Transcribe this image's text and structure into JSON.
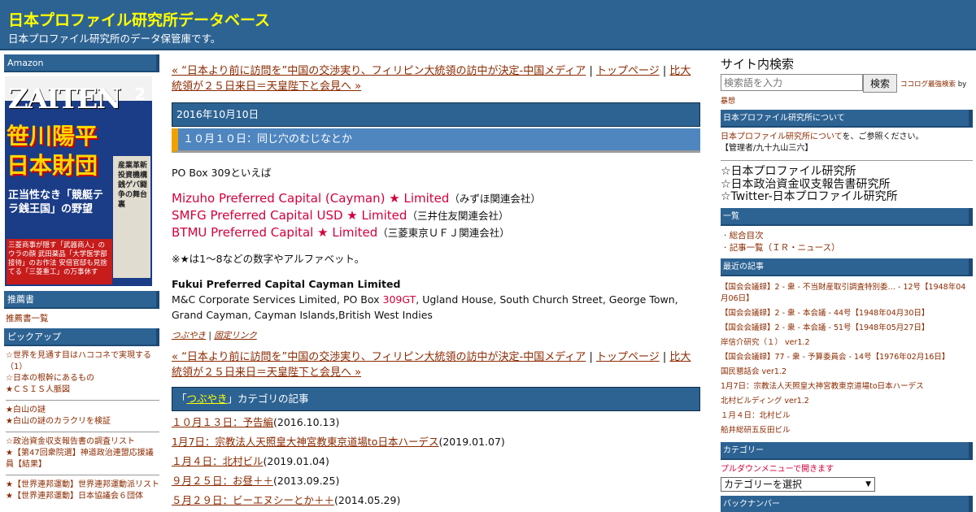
{
  "header": {
    "title": "日本プロファイル研究所データベース",
    "description": "日本プロファイル研究所のデータ保管庫です。"
  },
  "left": {
    "amazon_heading": "Amazon",
    "magazine": {
      "logo": "ZAITEN",
      "issue": "2",
      "headline": "笹川陽平 日本財団",
      "subline": "正当性なき「競艇テラ銭王国」の野望",
      "side_text": "産業革新投資機構 銭ゲバ闘争の舞台裏",
      "bottom_text": "三菱商事が隠す「武器商人」のウラの顔 武田薬品「大学医学部接待」のお作法 安倍官邸も見捨てる「三菱重工」の万事休す"
    },
    "recommend_heading": "推薦書",
    "recommend_link": "推薦書一覧",
    "pickup_heading": "ピックアップ",
    "pickup_groups": [
      [
        "☆世界を見通す目はハココネで実現する（1）",
        "☆日本の根幹にあるもの",
        "★ＣＳＩＳ人脈図"
      ],
      [
        "★白山の謎",
        "★白山の謎のカラクリを検証"
      ],
      [
        "☆政治資金収支報告書の調査リスト",
        "★【第47回衆院選】神道政治連盟応援議員【結果】"
      ],
      [
        "★【世界連邦運動】世界連邦運動派リスト",
        "★【世界連邦運動】日本協議会６団体"
      ]
    ]
  },
  "main": {
    "nav_prev": "« “日本より前に訪問を”中国の交渉実り、フィリピン大統領の訪中が決定-中国メディア",
    "nav_top": "トップページ",
    "nav_next": "比大統領が２５日来日＝天皇陛下と会見へ »",
    "nav_sep": " | ",
    "date": "2016年10月10日",
    "entry_title": "１０月１０日：同じ穴のむじなとか",
    "p1": "PO Box 309といえば",
    "red_lines": [
      {
        "name": "Mizuho Preferred Capital (Cayman) ★ Limited",
        "note": "（みずほ関連会社）"
      },
      {
        "name": "SMFG Preferred Capital USD ★ Limited",
        "note": "（三井住友関連会社）"
      },
      {
        "name": "BTMU Preferred Capital ★ Limited",
        "note": "（三菱東京ＵＦＪ関連会社）"
      }
    ],
    "p2": "※★は1〜8などの数字やアルファベット。",
    "company": "Fukui Preferred Capital Cayman Limited",
    "addr_prefix": "M&C Corporate Services Limited, PO Box ",
    "addr_highlight": "309GT",
    "addr_suffix": ", Ugland House, South Church Street, George Town, Grand Cayman, Cayman Islands,British West Indies",
    "cat_link": "つぶやき",
    "permalink": "固定リンク",
    "category_bar_prefix": "「",
    "category_bar_link": "つぶやき",
    "category_bar_suffix": "」カテゴリの記事",
    "category_items": [
      {
        "title": "１０月１３日：予告編",
        "date": "(2016.10.13)"
      },
      {
        "title": "1月7日：宗教法人天照皇大神宮教東京道場to日本ハーデス",
        "date": "(2019.01.07)"
      },
      {
        "title": "１月４日：北村ビル",
        "date": "(2019.01.04)"
      },
      {
        "title": "９月２５日：お昼＋＋",
        "date": "(2013.09.25)"
      },
      {
        "title": "５月２９日：ビーエヌシーとか＋＋",
        "date": "(2014.05.29)"
      }
    ]
  },
  "right": {
    "search_title": "サイト内検索",
    "search_placeholder": "検索語を入力",
    "search_button": "検索",
    "search_note": "ココログ最強検索",
    "search_by": " by",
    "search_note2": "暴想",
    "about_heading": "日本プロファイル研究所について",
    "about_link": "日本プロファイル研究所について",
    "about_suffix": "を、ご参照ください。",
    "admin": "【管理者/九十九山三六】",
    "big_links": [
      "☆日本プロファイル研究所",
      "☆日本政治資金収支報告書研究所",
      "☆Twitter-日本プロファイル研究所"
    ],
    "list_heading": "一覧",
    "list_items": [
      "総合目次",
      "記事一覧（ＩＲ・ニュース）"
    ],
    "recent_heading": "最近の記事",
    "recent_items": [
      "【国会会議録】2 - 衆 - 不当財産取引調査特別委… - 12号【1948年04月06日】",
      "【国会会議録】2 - 衆 - 本会議 - 44号【1948年04月30日】",
      "【国会会議録】2 - 衆 - 本会議 - 51号【1948年05月27日】",
      "岸信介研究（１） ver1.2",
      "【国会会議録】77 - 衆 - 予算委員会 - 14号【1976年02月16日】",
      "国民懇話会 ver1.2",
      "1月7日：宗教法人天照皇大神宮教東京道場to日本ハーデス",
      "北村ビルディング ver1.2",
      "１月４日：北村ビル",
      "船井総研五反田ビル"
    ],
    "category_heading": "カテゴリー",
    "category_note": "プルダウンメニューで開きます",
    "category_select": "カテゴリーを選択",
    "backnumber_heading": "バックナンバー"
  },
  "colors": {
    "header_bg": "#2d6393",
    "title_yellow": "#ffff00",
    "link_brown": "#8b2a00",
    "red_text": "#d4003a",
    "title_accent": "#f0a000"
  }
}
